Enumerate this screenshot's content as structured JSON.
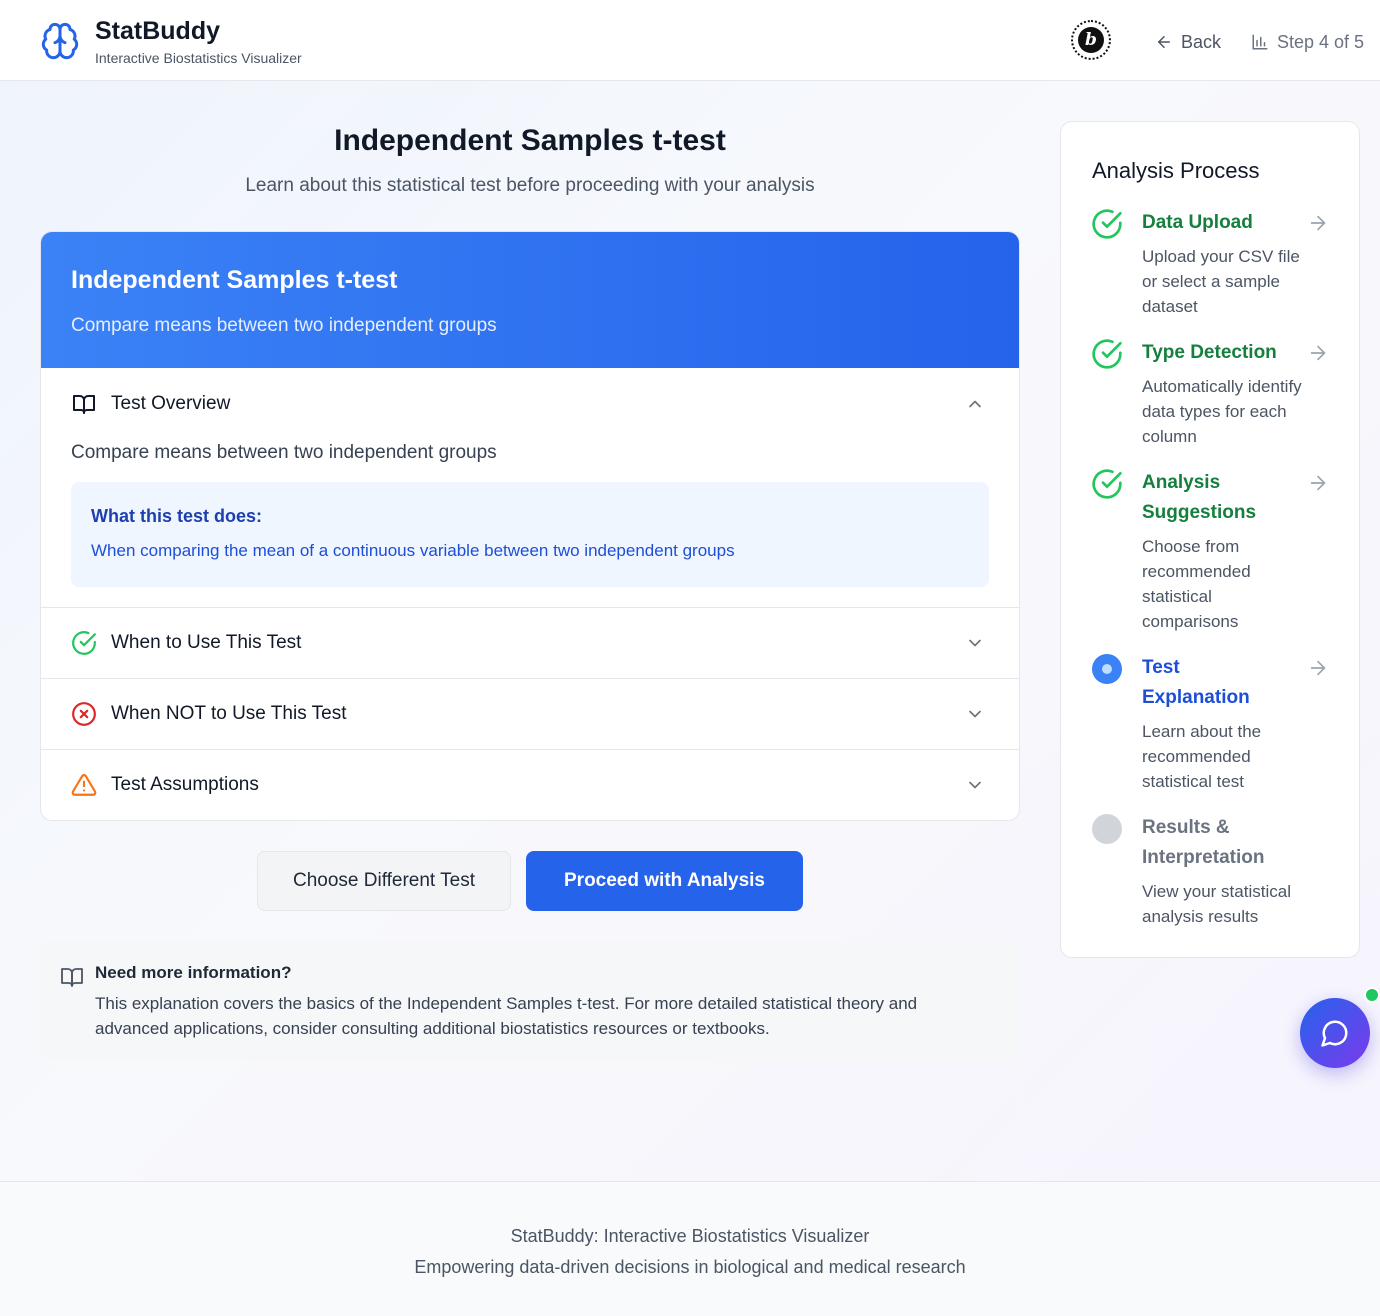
{
  "header": {
    "app_name": "StatBuddy",
    "app_subtitle": "Interactive Biostatistics Visualizer",
    "badge_letter": "b",
    "back_label": "Back",
    "step_indicator": "Step 4 of 5"
  },
  "main": {
    "title": "Independent Samples t-test",
    "subtitle": "Learn about this statistical test before proceeding with your analysis",
    "card": {
      "title": "Independent Samples t-test",
      "subtitle": "Compare means between two independent groups",
      "sections": [
        {
          "label": "Test Overview",
          "icon": "book-icon",
          "expanded": true,
          "description": "Compare means between two independent groups",
          "info_title": "What this test does:",
          "info_text": "When comparing the mean of a continuous variable between two independent groups"
        },
        {
          "label": "When to Use This Test",
          "icon": "check-circle-icon",
          "expanded": false
        },
        {
          "label": "When NOT to Use This Test",
          "icon": "x-circle-icon",
          "expanded": false
        },
        {
          "label": "Test Assumptions",
          "icon": "warning-icon",
          "expanded": false
        }
      ]
    },
    "buttons": {
      "choose_different": "Choose Different Test",
      "proceed": "Proceed with Analysis"
    },
    "more_info": {
      "title": "Need more information?",
      "text_line1": "This explanation covers the basics of the Independent Samples t-test. For more detailed statistical theory and",
      "text_line2": "advanced applications, consider consulting additional biostatistics resources or textbooks."
    }
  },
  "sidebar": {
    "title": "Analysis Process",
    "steps": [
      {
        "title": "Data Upload",
        "desc": "Upload your CSV file or select a sample dataset",
        "status": "done"
      },
      {
        "title": "Type Detection",
        "desc": "Automatically identify data types for each column",
        "status": "done"
      },
      {
        "title": "Analysis Suggestions",
        "desc": "Choose from recommended statistical comparisons",
        "status": "done"
      },
      {
        "title": "Test Explanation",
        "desc": "Learn about the recommended statistical test",
        "status": "active"
      },
      {
        "title": "Results & Interpretation",
        "desc": "View your statistical analysis results",
        "status": "pending"
      }
    ]
  },
  "footer": {
    "line1": "StatBuddy: Interactive Biostatistics Visualizer",
    "line2": "Empowering data-driven decisions in biological and medical research"
  },
  "colors": {
    "primary": "#2563eb",
    "success": "#22c55e",
    "danger": "#dc2626",
    "warning": "#f97316"
  }
}
